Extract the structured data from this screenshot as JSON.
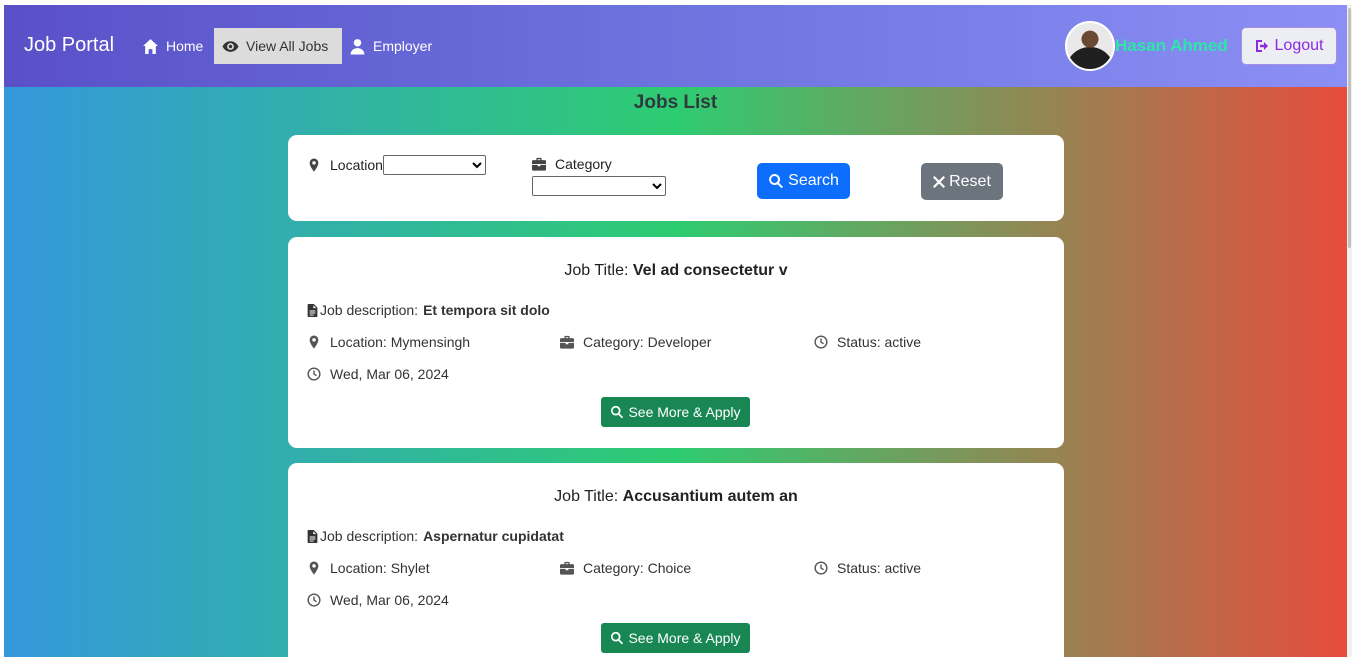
{
  "navbar": {
    "brand": "Job Portal",
    "items": [
      {
        "label": "Home",
        "icon": "home-icon"
      },
      {
        "label": "View All Jobs",
        "icon": "eye-icon"
      },
      {
        "label": "Employer",
        "icon": "user-icon"
      }
    ],
    "user_name": "Hasan Ahmed",
    "logout_label": "Logout"
  },
  "page_title": "Jobs List",
  "filters": {
    "location_label": "Location",
    "category_label": "Category",
    "search_label": "Search",
    "reset_label": "Reset"
  },
  "jobs": [
    {
      "title_prefix": "Job Title:",
      "title": "Vel ad consectetur v",
      "description_prefix": "Job description:",
      "description": "Et tempora sit dolo",
      "location": "Location: Mymensingh",
      "category": "Category: Developer",
      "status": "Status: active",
      "date": "Wed, Mar 06, 2024",
      "apply_label": "See More & Apply"
    },
    {
      "title_prefix": "Job Title:",
      "title": "Accusantium autem an",
      "description_prefix": "Job description:",
      "description": "Aspernatur cupidatat",
      "location": "Location: Shylet",
      "category": "Category: Choice",
      "status": "Status: active",
      "date": "Wed, Mar 06, 2024",
      "apply_label": "See More & Apply"
    }
  ],
  "colors": {
    "accent": "#0d6efd",
    "apply": "#198754",
    "reset": "#6c757d",
    "username": "#2ee6a8",
    "logout": "#8a2be2"
  }
}
